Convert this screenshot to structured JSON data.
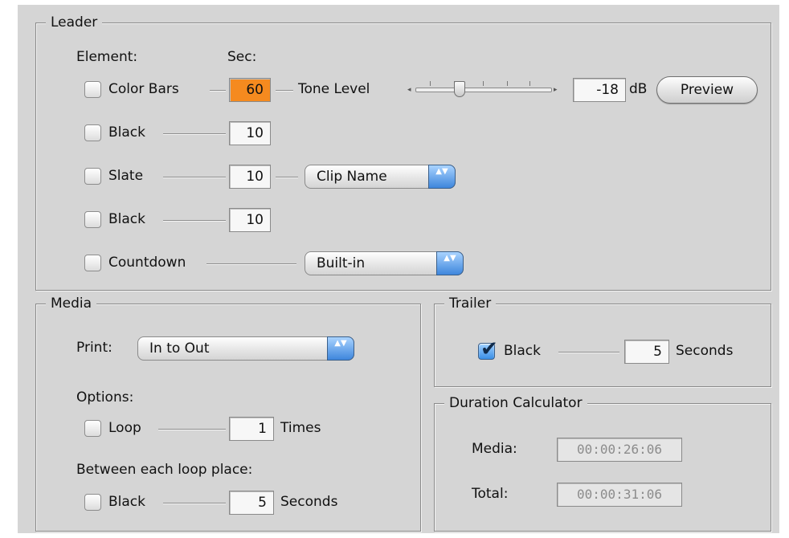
{
  "leader": {
    "title": "Leader",
    "element_header": "Element:",
    "sec_header": "Sec:",
    "rows": [
      {
        "label": "Color Bars",
        "seconds": "60",
        "checked": false
      },
      {
        "label": "Black",
        "seconds": "10",
        "checked": false
      },
      {
        "label": "Slate",
        "seconds": "10",
        "checked": false
      },
      {
        "label": "Black",
        "seconds": "10",
        "checked": false
      },
      {
        "label": "Countdown",
        "checked": false
      }
    ],
    "tone_level_label": "Tone Level",
    "tone_value": "-18",
    "tone_unit": "dB",
    "preview_label": "Preview",
    "slate_select": "Clip Name",
    "countdown_select": "Built-in"
  },
  "media": {
    "title": "Media",
    "print_label": "Print:",
    "print_select": "In to Out",
    "options_label": "Options:",
    "loop_label": "Loop",
    "loop_count": "1",
    "loop_unit": "Times",
    "between_label": "Between each loop place:",
    "black_label": "Black",
    "black_seconds": "5",
    "black_unit": "Seconds"
  },
  "trailer": {
    "title": "Trailer",
    "black_label": "Black",
    "black_checked": true,
    "seconds": "5",
    "unit": "Seconds"
  },
  "duration": {
    "title": "Duration Calculator",
    "media_label": "Media:",
    "media_value": "00:00:26:06",
    "total_label": "Total:",
    "total_value": "00:00:31:06"
  },
  "icons": {
    "checkmark": "✔",
    "select_arrows": "▲▼",
    "slider_left": "◂",
    "slider_right": "▸"
  }
}
